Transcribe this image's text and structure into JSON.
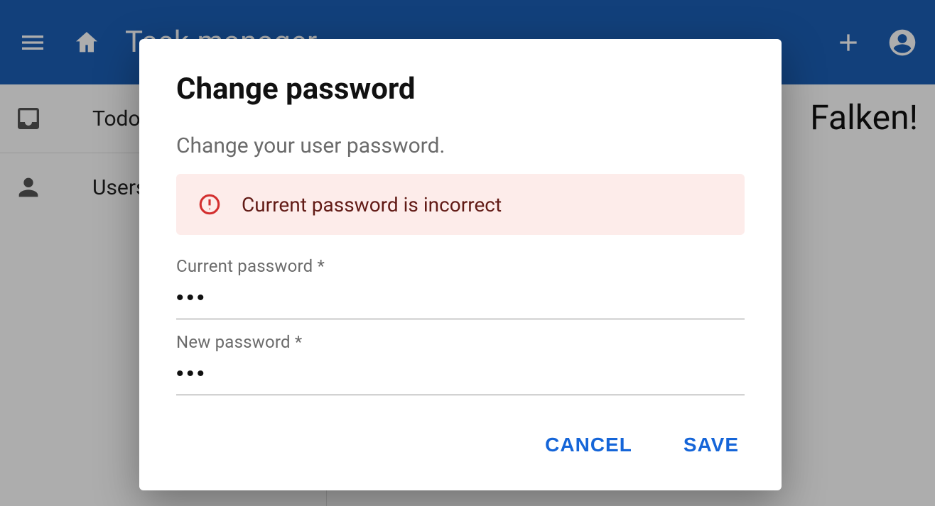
{
  "appbar": {
    "title": "Task manager"
  },
  "sidebar": {
    "items": [
      {
        "label": "Todo"
      },
      {
        "label": "Users"
      }
    ]
  },
  "main": {
    "greeting_fragment": "Falken!"
  },
  "dialog": {
    "title": "Change password",
    "subtitle": "Change your user password.",
    "error": "Current password is incorrect",
    "current_label": "Current password *",
    "current_value": "•••",
    "new_label": "New password *",
    "new_value": "•••",
    "cancel": "CANCEL",
    "save": "SAVE"
  }
}
